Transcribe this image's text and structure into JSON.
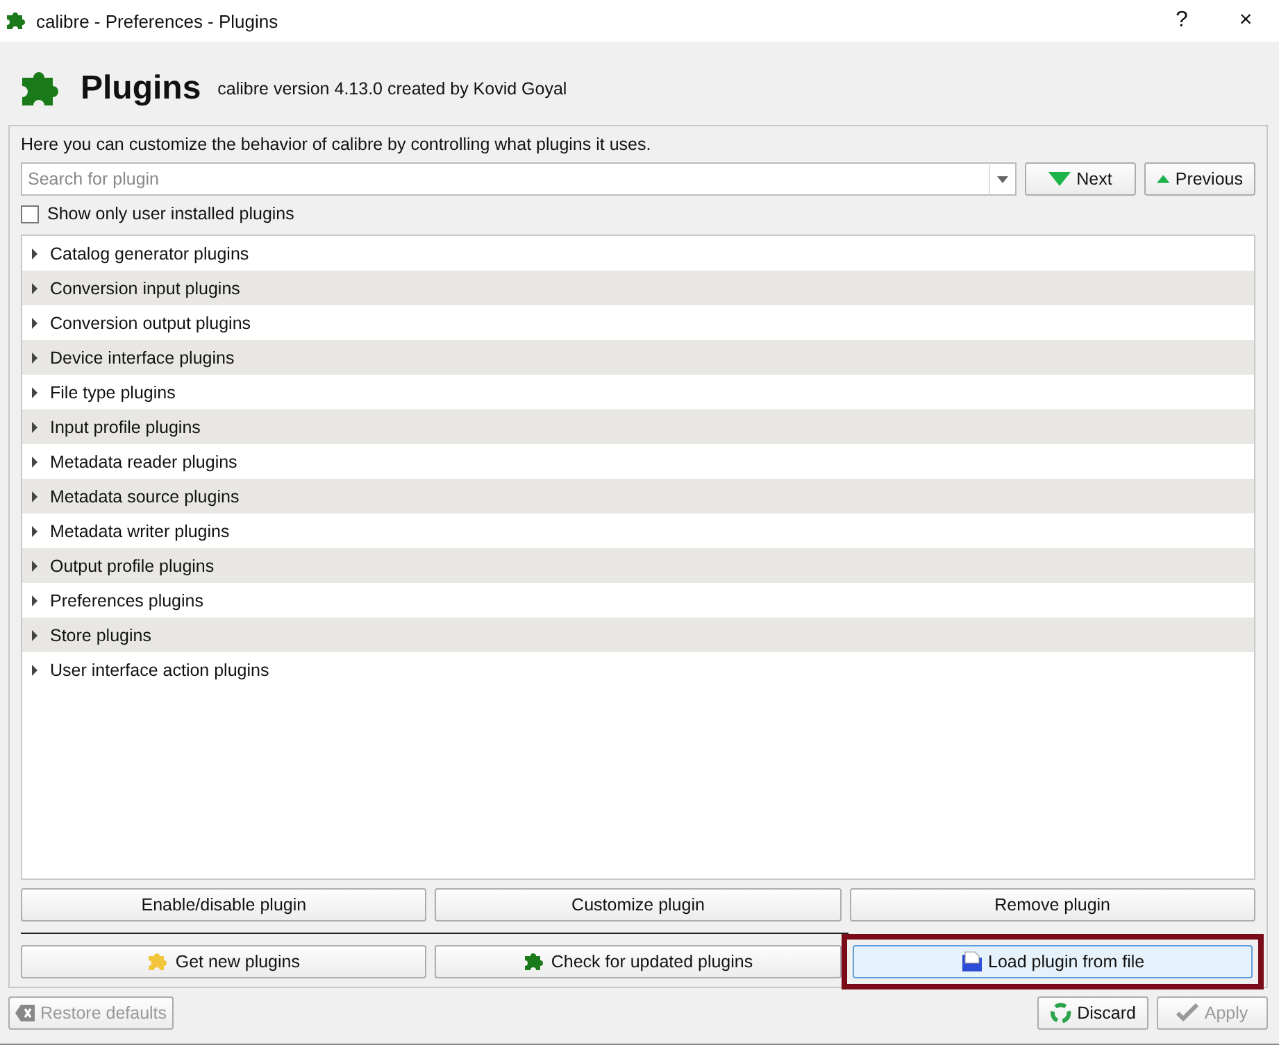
{
  "window": {
    "title": "calibre - Preferences - Plugins",
    "controls": [
      "?",
      "×"
    ]
  },
  "header": {
    "title": "Plugins",
    "subtitle": "calibre version 4.13.0 created by Kovid Goyal"
  },
  "description": "Here you can customize the behavior of calibre by controlling what plugins it uses.",
  "search": {
    "placeholder": "Search for plugin"
  },
  "nav_buttons": [
    {
      "label": "Next",
      "kind": "down"
    },
    {
      "label": "Previous",
      "kind": "up"
    }
  ],
  "user_only": {
    "label": "Show only user installed plugins",
    "checked": false
  },
  "tree": [
    {
      "label": "Catalog generator plugins",
      "expanded": false
    },
    {
      "label": "Conversion input plugins",
      "expanded": false
    },
    {
      "label": "Conversion output plugins",
      "expanded": false
    },
    {
      "label": "Device interface plugins",
      "expanded": false
    },
    {
      "label": "File type plugins",
      "expanded": false
    },
    {
      "label": "Input profile plugins",
      "expanded": false
    },
    {
      "label": "Metadata reader plugins",
      "expanded": false
    },
    {
      "label": "Metadata source plugins",
      "expanded": false
    },
    {
      "label": "Metadata writer plugins",
      "expanded": false
    },
    {
      "label": "Output profile plugins",
      "expanded": false
    },
    {
      "label": "Preferences plugins",
      "expanded": false
    },
    {
      "label": "Store plugins",
      "expanded": false
    },
    {
      "label": "User interface action plugins",
      "expanded": false
    }
  ],
  "action_buttons": [
    {
      "label": "Enable/disable plugin"
    },
    {
      "label": "Customize plugin"
    },
    {
      "label": "Remove plugin"
    }
  ],
  "plugin_buttons": [
    {
      "label": "Get new plugins",
      "kind": "get",
      "highlighted": false
    },
    {
      "label": "Check for updated plugins",
      "kind": "check",
      "highlighted": false
    },
    {
      "label": "Load plugin from file",
      "kind": "load",
      "highlighted": true
    }
  ],
  "footer": {
    "restore": {
      "label": "Restore defaults",
      "disabled": true
    },
    "buttons": [
      {
        "label": "Discard",
        "kind": "discard",
        "disabled": false
      },
      {
        "label": "Apply",
        "kind": "apply",
        "disabled": true
      }
    ]
  }
}
